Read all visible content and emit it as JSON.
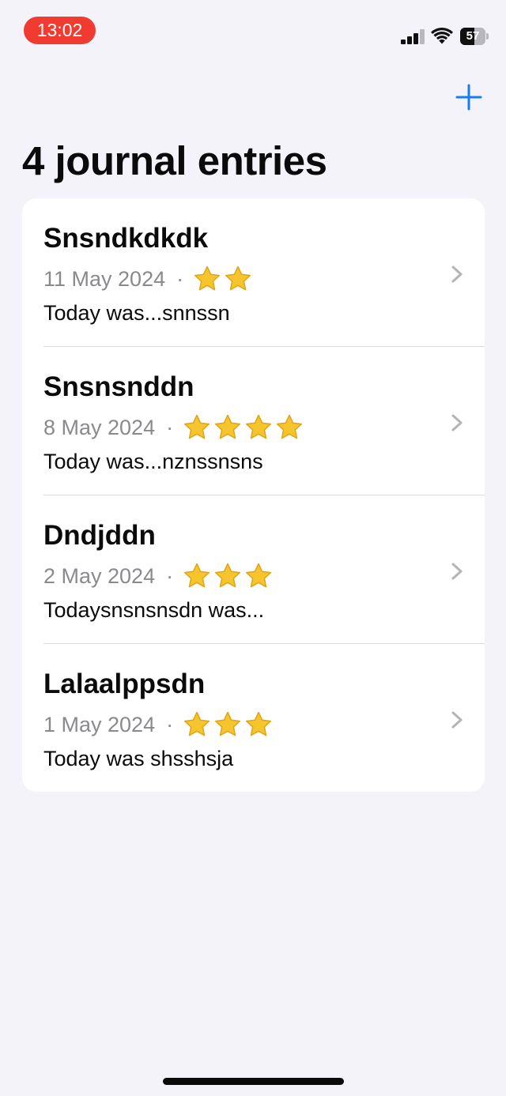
{
  "status_bar": {
    "time": "13:02",
    "battery_level": "57"
  },
  "nav": {
    "title": "4 journal entries",
    "add_icon": "plus-icon"
  },
  "entries": [
    {
      "title": "Snsndkdkdk",
      "date": "11 May 2024",
      "separator": "·",
      "rating": 2,
      "preview": "Today was...snnssn"
    },
    {
      "title": "Snsnsnddn",
      "date": "8 May 2024",
      "separator": "·",
      "rating": 4,
      "preview": "Today was...nznssnsns"
    },
    {
      "title": "Dndjddn",
      "date": "2 May 2024",
      "separator": "·",
      "rating": 3,
      "preview": "Todaysnsnsnsdn was..."
    },
    {
      "title": "Lalaalppsdn",
      "date": "1 May 2024",
      "separator": "·",
      "rating": 3,
      "preview": "Today was shsshsja"
    }
  ],
  "colors": {
    "accent": "#1A7CF5",
    "background": "#F3F3F9",
    "card": "#FFFFFF",
    "secondary_text": "#8A8A8E",
    "status_time_pill": "#F23B30",
    "star": "#F6C52E"
  },
  "icons": {
    "rating": "star-icon",
    "disclosure": "chevron-right-icon",
    "signal": "cellular-signal-icon",
    "wifi": "wifi-icon",
    "battery": "battery-icon"
  }
}
